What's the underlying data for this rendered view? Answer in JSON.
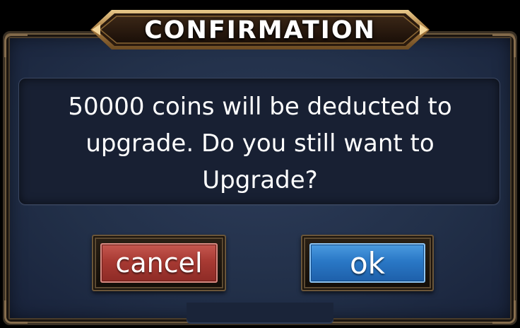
{
  "dialog": {
    "title": "CONFIRMATION",
    "message": "50000 coins will be deducted to upgrade. Do you still want to Upgrade?",
    "buttons": {
      "cancel_label": "cancel",
      "ok_label": "ok"
    }
  },
  "colors": {
    "background": "#223049",
    "frame": "#6e5a3e",
    "cancel_button": "#a83a33",
    "ok_button": "#2a78c6",
    "title_banner": "#24170e",
    "text": "#ffffff"
  }
}
